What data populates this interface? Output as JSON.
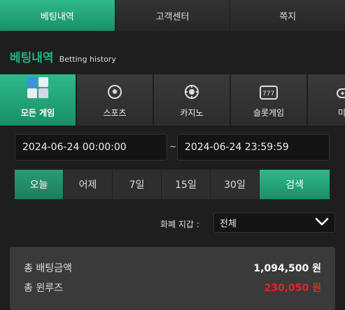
{
  "top_tabs": [
    {
      "label": "베팅내역"
    },
    {
      "label": "고객센터"
    },
    {
      "label": "쪽지"
    }
  ],
  "heading": {
    "title": "베팅내역",
    "subtitle": "Betting history"
  },
  "categories": [
    {
      "label": "모든 게임",
      "icon": "all-games-icon"
    },
    {
      "label": "스포츠",
      "icon": "soccer-ball-icon"
    },
    {
      "label": "카지노",
      "icon": "casino-chip-icon"
    },
    {
      "label": "슬롯게임",
      "icon": "slot-machine-icon"
    },
    {
      "label": "미니",
      "icon": "gamepad-icon"
    }
  ],
  "date_range": {
    "start": "2024-06-24 00:00:00",
    "separator": "~",
    "end": "2024-06-24 23:59:59"
  },
  "periods": [
    {
      "label": "오늘"
    },
    {
      "label": "어제"
    },
    {
      "label": "7일"
    },
    {
      "label": "15일"
    },
    {
      "label": "30일"
    }
  ],
  "search_label": "검색",
  "currency": {
    "label": "화폐 지갑 :",
    "value": "전체"
  },
  "summary": {
    "total_bet_label": "총 배팅금액",
    "total_bet_value": "1,094,500 원",
    "total_winloss_label": "총 윈루즈",
    "total_winloss_value": "230,050 원"
  },
  "colors": {
    "accent": "#26b083",
    "negative": "#e2262a"
  }
}
